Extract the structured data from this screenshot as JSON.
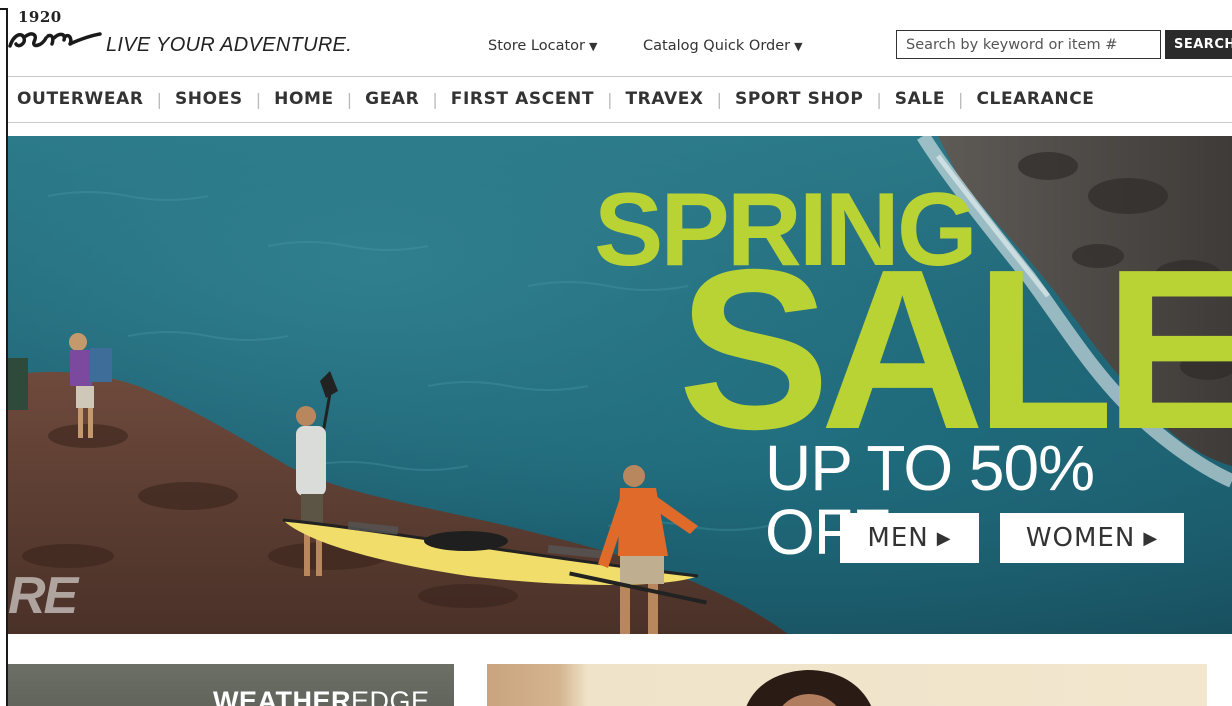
{
  "brand": {
    "year": "1920",
    "tagline": "LIVE YOUR ADVENTURE."
  },
  "header": {
    "store_locator": "Store Locator",
    "catalog_quick_order": "Catalog Quick Order",
    "search_placeholder": "Search by keyword or item #",
    "search_button": "SEARCH"
  },
  "nav": {
    "items": [
      {
        "label": "OUTERWEAR"
      },
      {
        "label": "SHOES"
      },
      {
        "label": "HOME"
      },
      {
        "label": "GEAR"
      },
      {
        "label": "FIRST ASCENT"
      },
      {
        "label": "TRAVEX"
      },
      {
        "label": "SPORT SHOP"
      },
      {
        "label": "SALE"
      },
      {
        "label": "CLEARANCE"
      }
    ]
  },
  "hero": {
    "headline_1": "SPRING",
    "headline_2": "SALE",
    "subhead": "UP TO 50% OFF",
    "cta_men": "MEN",
    "cta_women": "WOMEN",
    "watermark": "RE"
  },
  "promos": {
    "weatheredge_bold": "WEATHER",
    "weatheredge_light": "EDGE"
  },
  "colors": {
    "accent_lime": "#b9d234",
    "search_button_bg": "#2b2b2b",
    "text_dark": "#333333"
  }
}
